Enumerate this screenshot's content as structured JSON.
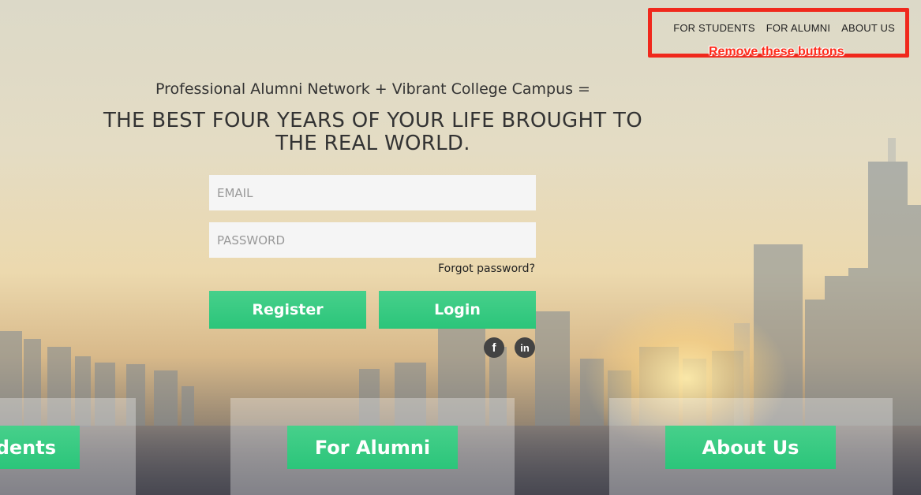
{
  "nav": {
    "items": [
      "FOR STUDENTS",
      "FOR ALUMNI",
      "ABOUT US"
    ]
  },
  "annotation": {
    "text": "Remove these buttons",
    "color": "#f0281c"
  },
  "hero": {
    "tagline": "Professional Alumni Network + Vibrant College Campus =",
    "headline": "THE BEST FOUR YEARS OF YOUR LIFE BROUGHT TO THE REAL WORLD."
  },
  "form": {
    "email_placeholder": "EMAIL",
    "password_placeholder": "PASSWORD",
    "forgot_label": "Forgot password?",
    "register_label": "Register",
    "login_label": "Login"
  },
  "social": {
    "facebook_glyph": "f",
    "linkedin_glyph": "in"
  },
  "panels": {
    "students_label": "udents",
    "alumni_label": "For Alumni",
    "about_label": "About Us"
  },
  "colors": {
    "accent_green": "#2bc57a",
    "text_dark": "#333333"
  }
}
